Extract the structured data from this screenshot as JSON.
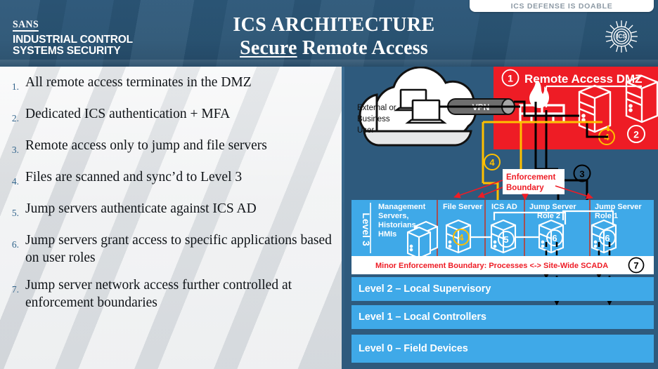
{
  "header": {
    "tab_label": "ICS DEFENSE IS DOABLE",
    "logo_sans": "SANS",
    "logo_sub_line1": "INDUSTRIAL CONTROL",
    "logo_sub_line2": "SYSTEMS SECURITY",
    "gear_label": "ICS",
    "title_line1": "ICS ARCHITECTURE",
    "title_line2_underlined": "Secure",
    "title_line2_rest": " Remote Access",
    "bg_color": "#2e5a7d",
    "text_color": "#ffffff"
  },
  "bullets": {
    "items": [
      {
        "num": "1.",
        "text": "All remote access terminates in the DMZ"
      },
      {
        "num": "2.",
        "text": "Dedicated ICS authentication + MFA"
      },
      {
        "num": "3.",
        "text": "Remote access only to jump and file servers"
      },
      {
        "num": "4.",
        "text": "Files are scanned and sync’d to Level 3"
      },
      {
        "num": "5.",
        "text": "Jump servers authenticate against ICS AD"
      },
      {
        "num": "6.",
        "text": "Jump servers grant access to specific applications based on user roles"
      },
      {
        "num": "7.",
        "text": "Jump server network access further controlled at enforcement boundaries"
      }
    ]
  },
  "diagram": {
    "bg_color": "#2e5a7d",
    "dmz": {
      "title": "Remote Access DMZ",
      "badge": "1",
      "bg_color": "#ee1c25",
      "server_jump_badge": "4",
      "server_right_badge": "2"
    },
    "cloud": {
      "label_line1": "External or",
      "label_line2": "Business",
      "label_line3": "User"
    },
    "vpn": {
      "label": "VPN"
    },
    "callout": {
      "line1": "Enforcement",
      "line2": "Boundary",
      "color": "#ee1c25"
    },
    "badges": {
      "gold_4": "4",
      "black_3": "3",
      "circle_7": "7"
    },
    "level3": {
      "side_label": "Level 3",
      "bg_color": "#3fa9e8",
      "columns": [
        {
          "label": "Management Servers, Historians, HMIs",
          "label_lines": [
            "Management",
            "Servers,",
            "Historians,",
            "HMIs"
          ],
          "badge": ""
        },
        {
          "label": "File Server",
          "label_lines": [
            "File Server"
          ],
          "badge": "4"
        },
        {
          "label": "ICS AD",
          "label_lines": [
            "ICS AD"
          ],
          "badge": "5"
        },
        {
          "label": "Jump Server Role 2",
          "label_lines": [
            "Jump Server",
            "Role 2"
          ],
          "badge": "6"
        },
        {
          "label": "Jump Server Role 1",
          "label_lines": [
            "Jump Server",
            "Role 1"
          ],
          "badge": "6"
        }
      ]
    },
    "minor_boundary": {
      "text": "Minor Enforcement Boundary: Processes <-> Site-Wide SCADA",
      "badge": "7"
    },
    "levels": [
      {
        "label": "Level 2 – Local Supervisory"
      },
      {
        "label": "Level 1 – Local Controllers"
      },
      {
        "label": "Level 0 – Field Devices"
      }
    ]
  }
}
